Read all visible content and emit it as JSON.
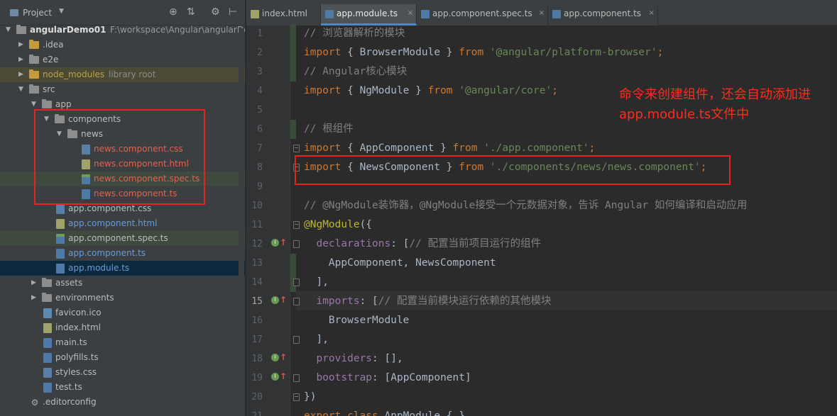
{
  "project_panel": {
    "title": "Project",
    "header_icons": [
      "crosshair-icon",
      "collapse-icon",
      "settings-icon",
      "hide-icon"
    ],
    "tree": [
      {
        "name": "angularDemo01",
        "extra": "F:\\workspace\\Angular\\angularDemo01",
        "kind": "project",
        "indent": 0,
        "expanded": true
      },
      {
        "name": ".idea",
        "kind": "folder",
        "indent": 1,
        "expanded": false
      },
      {
        "name": "e2e",
        "kind": "folder",
        "indent": 1,
        "expanded": false
      },
      {
        "name": "node_modules",
        "extra": "library root",
        "kind": "folder-excluded",
        "indent": 1,
        "expanded": false
      },
      {
        "name": "src",
        "kind": "folder",
        "indent": 1,
        "expanded": true
      },
      {
        "name": "app",
        "kind": "folder",
        "indent": 2,
        "expanded": true
      },
      {
        "name": "components",
        "kind": "folder",
        "indent": 3,
        "expanded": true
      },
      {
        "name": "news",
        "kind": "folder",
        "indent": 4,
        "expanded": true
      },
      {
        "name": "news.component.css",
        "kind": "css",
        "indent": 5,
        "color": "red"
      },
      {
        "name": "news.component.html",
        "kind": "html",
        "indent": 5,
        "color": "red"
      },
      {
        "name": "news.component.spec.ts",
        "kind": "spec",
        "indent": 5,
        "color": "red"
      },
      {
        "name": "news.component.ts",
        "kind": "ts",
        "indent": 5,
        "color": "red"
      },
      {
        "name": "app.component.css",
        "kind": "css",
        "indent": 3,
        "color": "normal"
      },
      {
        "name": "app.component.html",
        "kind": "html",
        "indent": 3,
        "color": "blue"
      },
      {
        "name": "app.component.spec.ts",
        "kind": "spec",
        "indent": 3,
        "color": "normal"
      },
      {
        "name": "app.component.ts",
        "kind": "ts",
        "indent": 3,
        "color": "blue"
      },
      {
        "name": "app.module.ts",
        "kind": "ts",
        "indent": 3,
        "color": "blue"
      },
      {
        "name": "assets",
        "kind": "folder",
        "indent": 2,
        "expanded": false
      },
      {
        "name": "environments",
        "kind": "folder",
        "indent": 2,
        "expanded": false
      },
      {
        "name": "favicon.ico",
        "kind": "ico",
        "indent": 2,
        "color": "normal"
      },
      {
        "name": "index.html",
        "kind": "html",
        "indent": 2,
        "color": "normal"
      },
      {
        "name": "main.ts",
        "kind": "ts",
        "indent": 2,
        "color": "normal"
      },
      {
        "name": "polyfills.ts",
        "kind": "ts",
        "indent": 2,
        "color": "normal"
      },
      {
        "name": "styles.css",
        "kind": "css",
        "indent": 2,
        "color": "normal"
      },
      {
        "name": "test.ts",
        "kind": "ts",
        "indent": 2,
        "color": "normal"
      },
      {
        "name": ".editorconfig",
        "kind": "gear",
        "indent": 1,
        "color": "normal"
      }
    ]
  },
  "editor": {
    "tabs": [
      {
        "label": "index.html",
        "icon": "html-file-icon",
        "active": false
      },
      {
        "label": "app.module.ts",
        "icon": "ts-file-icon",
        "active": true
      },
      {
        "label": "app.component.spec.ts",
        "icon": "ts-file-icon",
        "active": false
      },
      {
        "label": "app.component.ts",
        "icon": "ts-file-icon",
        "active": false
      }
    ],
    "current_line": 15,
    "lines": [
      {
        "n": 1,
        "tokens": [
          [
            "cm",
            "// 浏览器解析的模块"
          ]
        ]
      },
      {
        "n": 2,
        "tokens": [
          [
            "kw",
            "import"
          ],
          [
            "id",
            " { BrowserModule } "
          ],
          [
            "kw",
            "from"
          ],
          [
            "id",
            " "
          ],
          [
            "str",
            "'@angular/platform-browser'"
          ],
          [
            "kw",
            ";"
          ]
        ]
      },
      {
        "n": 3,
        "tokens": [
          [
            "cm",
            "// Angular核心模块"
          ]
        ]
      },
      {
        "n": 4,
        "tokens": [
          [
            "kw",
            "import"
          ],
          [
            "id",
            " { NgModule } "
          ],
          [
            "kw",
            "from"
          ],
          [
            "id",
            " "
          ],
          [
            "str",
            "'@angular/core'"
          ],
          [
            "kw",
            ";"
          ]
        ]
      },
      {
        "n": 5,
        "tokens": []
      },
      {
        "n": 6,
        "tokens": [
          [
            "cm",
            "// 根组件"
          ]
        ]
      },
      {
        "n": 7,
        "tokens": [
          [
            "kw",
            "import"
          ],
          [
            "id",
            " { AppComponent } "
          ],
          [
            "kw",
            "from"
          ],
          [
            "id",
            " "
          ],
          [
            "str",
            "'./app.component'"
          ],
          [
            "kw",
            ";"
          ]
        ]
      },
      {
        "n": 8,
        "tokens": [
          [
            "kw",
            "import"
          ],
          [
            "id",
            " { NewsComponent } "
          ],
          [
            "kw",
            "from"
          ],
          [
            "id",
            " "
          ],
          [
            "str",
            "'./components/news/news.component'"
          ],
          [
            "kw",
            ";"
          ]
        ]
      },
      {
        "n": 9,
        "tokens": []
      },
      {
        "n": 10,
        "tokens": [
          [
            "cm",
            "// @NgModule装饰器，@NgModule接受一个元数据对象，告诉 Angular 如何编译和启动应用"
          ]
        ]
      },
      {
        "n": 11,
        "tokens": [
          [
            "ann",
            "@NgModule"
          ],
          [
            "id",
            "({"
          ]
        ]
      },
      {
        "n": 12,
        "tokens": [
          [
            "id",
            "  "
          ],
          [
            "prop",
            "declarations"
          ],
          [
            "id",
            ": ["
          ],
          [
            "cm",
            "// 配置当前项目运行的组件"
          ]
        ]
      },
      {
        "n": 13,
        "tokens": [
          [
            "id",
            "    AppComponent, NewsComponent"
          ]
        ]
      },
      {
        "n": 14,
        "tokens": [
          [
            "id",
            "  ],"
          ]
        ]
      },
      {
        "n": 15,
        "tokens": [
          [
            "id",
            "  "
          ],
          [
            "prop",
            "imports"
          ],
          [
            "id",
            ": ["
          ],
          [
            "cm",
            "// 配置当前模块运行依赖的其他模块"
          ]
        ]
      },
      {
        "n": 16,
        "tokens": [
          [
            "id",
            "    BrowserModule"
          ]
        ]
      },
      {
        "n": 17,
        "tokens": [
          [
            "id",
            "  ],"
          ]
        ]
      },
      {
        "n": 18,
        "tokens": [
          [
            "id",
            "  "
          ],
          [
            "prop",
            "providers"
          ],
          [
            "id",
            ": [],"
          ]
        ]
      },
      {
        "n": 19,
        "tokens": [
          [
            "id",
            "  "
          ],
          [
            "prop",
            "bootstrap"
          ],
          [
            "id",
            ": [AppComponent]"
          ]
        ]
      },
      {
        "n": 20,
        "tokens": [
          [
            "id",
            "})"
          ]
        ]
      },
      {
        "n": 21,
        "tokens": [
          [
            "kw",
            "export class"
          ],
          [
            "id",
            " AppModule { }"
          ]
        ]
      }
    ]
  },
  "annotation": {
    "note": "命令来创建组件，还会自动添加进 app.module.ts文件中",
    "color": "#e6231e"
  },
  "colors": {
    "keyword": "#cc7832",
    "string": "#6a8759",
    "comment": "#808080",
    "annotation": "#bbb529",
    "property": "#9876aa",
    "new_file": "#e0624e",
    "modified_file": "#6a9bd8"
  }
}
